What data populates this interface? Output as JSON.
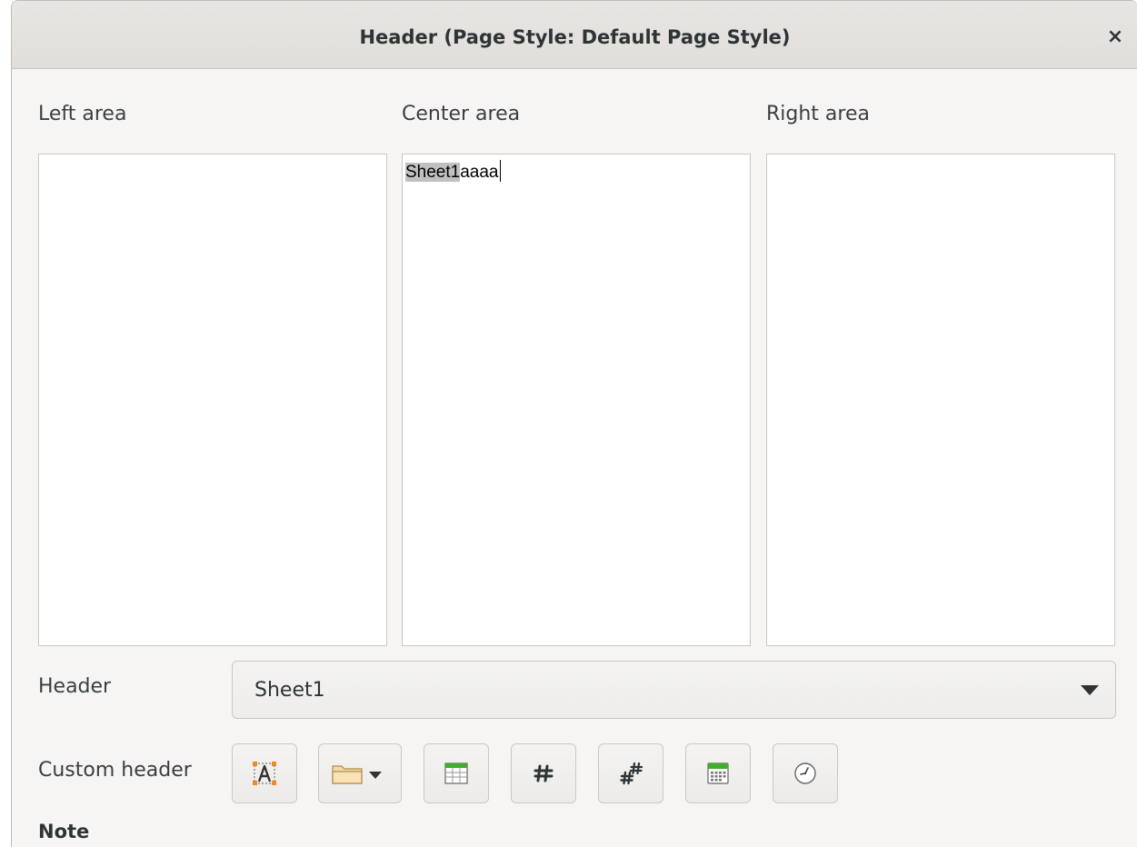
{
  "dialog": {
    "title": "Header (Page Style: Default Page Style)",
    "close_glyph": "×"
  },
  "areas": {
    "left_label": "Left area",
    "center_label": "Center area",
    "right_label": "Right area",
    "center_selected_text": "Sheet1",
    "center_rest_text": "aaaa"
  },
  "header_row": {
    "label": "Header",
    "selected_value": "Sheet1"
  },
  "custom_header": {
    "label": "Custom header",
    "buttons": [
      {
        "icon": "text-attributes-icon"
      },
      {
        "icon": "title-folder-dropdown-icon"
      },
      {
        "icon": "sheet-name-icon"
      },
      {
        "icon": "page-number-icon"
      },
      {
        "icon": "page-count-icon"
      },
      {
        "icon": "date-icon"
      },
      {
        "icon": "time-icon"
      }
    ]
  },
  "note": {
    "label": "Note"
  },
  "colors": {
    "dialog_bg": "#f6f5f4",
    "titlebar_bg": "#e0ddda",
    "selection_bg": "#c0c0c0",
    "table_green": "#3fae2a"
  }
}
